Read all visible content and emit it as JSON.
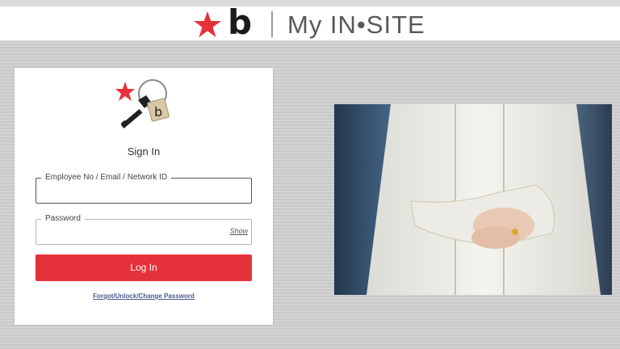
{
  "header": {
    "brand_mark": "b",
    "title": "My IN•SITE"
  },
  "login": {
    "title": "Sign In",
    "employee_label": "Employee No / Email / Network ID",
    "employee_value": "",
    "password_label": "Password",
    "password_value": "",
    "show_label": "Show",
    "login_button": "Log In",
    "forgot_link": "Forgot/Unlock/Change Password"
  },
  "logo": {
    "tag_letter": "b"
  },
  "colors": {
    "brand_red": "#e5313a",
    "link": "#4d5a8f",
    "brand_grey": "#58585a"
  },
  "photo": {
    "content": "person-in-white-robe-hands-clasped"
  }
}
